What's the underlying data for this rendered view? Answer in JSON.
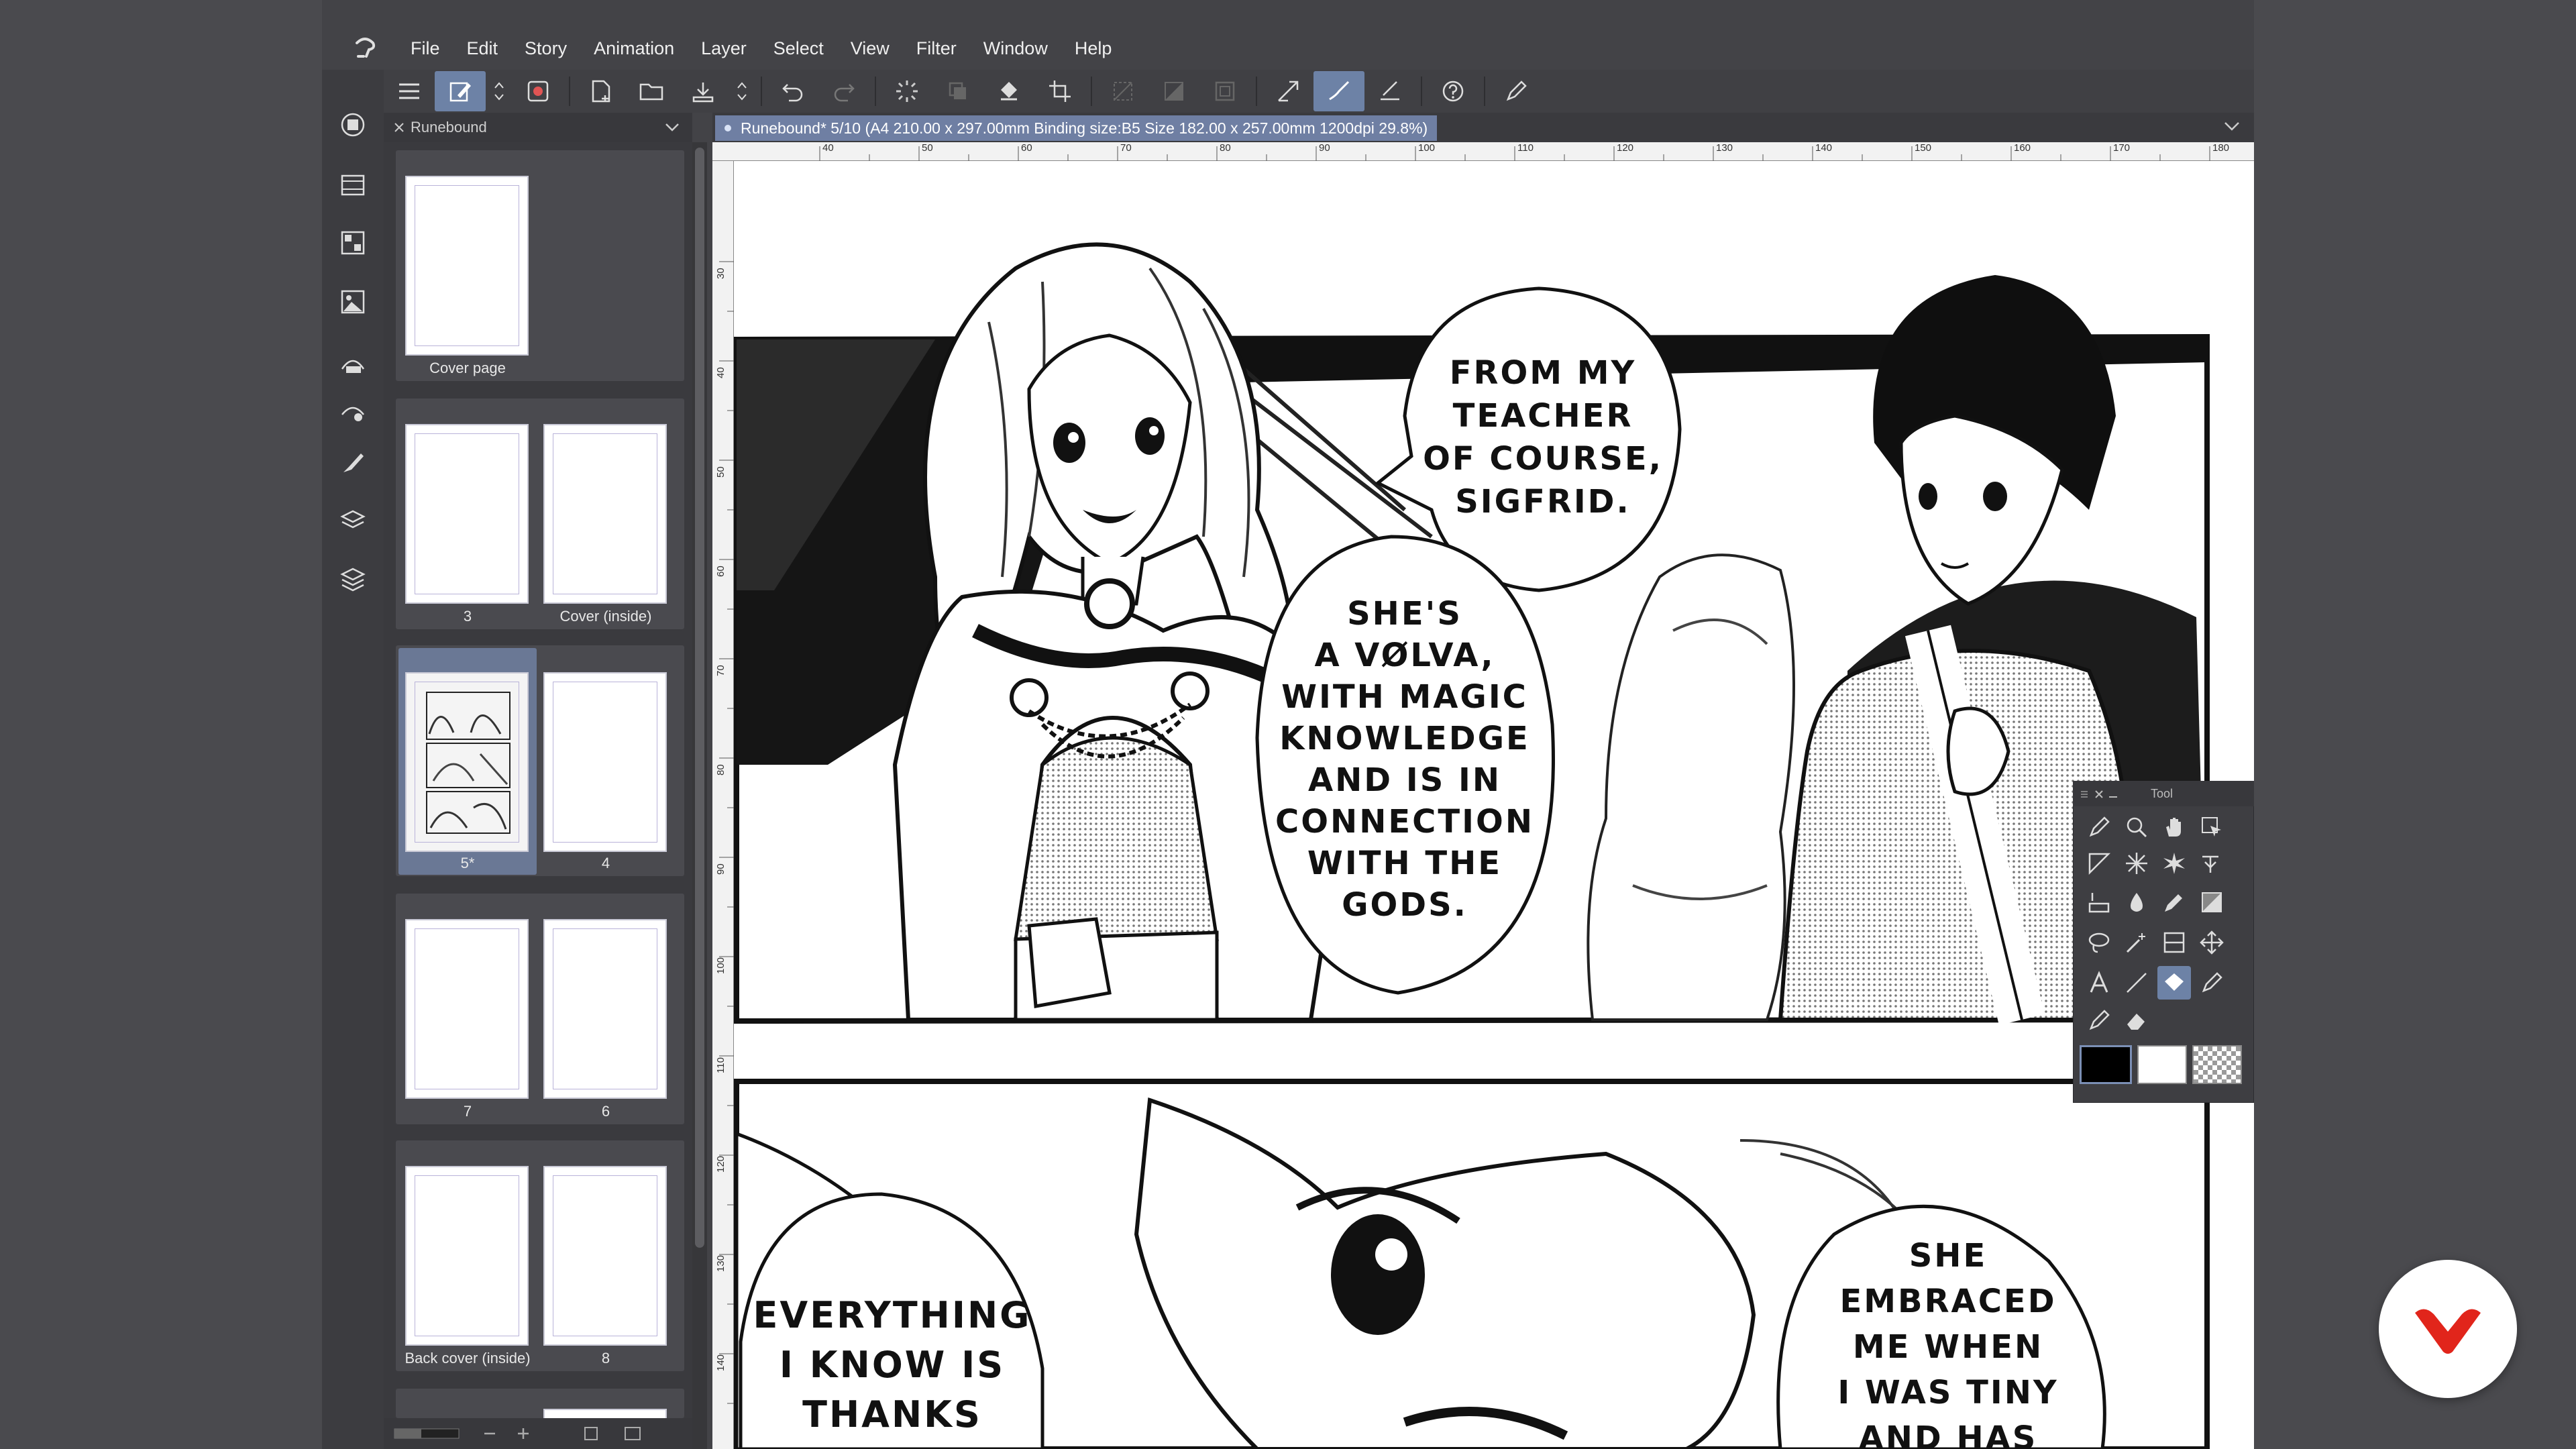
{
  "menu": [
    "File",
    "Edit",
    "Story",
    "Animation",
    "Layer",
    "Select",
    "View",
    "Filter",
    "Window",
    "Help"
  ],
  "page_manager": {
    "title": "Runebound",
    "pages": [
      {
        "label": "Cover page"
      },
      {
        "label": "3"
      },
      {
        "label": "Cover (inside)"
      },
      {
        "label": "5*"
      },
      {
        "label": "4"
      },
      {
        "label": "7"
      },
      {
        "label": "6"
      },
      {
        "label": "Back cover (inside)"
      },
      {
        "label": "8"
      }
    ]
  },
  "document_tab": "Runebound* 5/10 (A4 210.00 x 297.00mm Binding size:B5 Size 182.00 x 257.00mm 1200dpi 29.8%)",
  "ruler": {
    "top": [
      "40",
      "50",
      "60",
      "70",
      "80",
      "90",
      "100",
      "110",
      "120",
      "130",
      "140",
      "150",
      "160",
      "170",
      "180"
    ],
    "left": [
      "30",
      "40",
      "50",
      "60",
      "70",
      "80",
      "90",
      "100",
      "110",
      "120",
      "130",
      "140"
    ]
  },
  "bubbles": [
    {
      "lines": [
        "FROM MY",
        "TEACHER",
        "OF COURSE,",
        "SIGFRID."
      ]
    },
    {
      "lines": [
        "SHE'S",
        "A VØLVA,",
        "WITH MAGIC",
        "KNOWLEDGE",
        "AND IS IN",
        "CONNECTION",
        "WITH THE",
        "GODS."
      ]
    },
    {
      "lines": [
        "EVERYTHING",
        "I KNOW IS",
        "THANKS"
      ]
    },
    {
      "lines": [
        "SHE",
        "EMBRACED",
        "ME WHEN",
        "I WAS TINY",
        "AND HAS"
      ]
    }
  ],
  "tool_palette": {
    "title": "Tool"
  },
  "colors": {
    "accent": "#6d82a6",
    "badge": "#e1251b"
  }
}
